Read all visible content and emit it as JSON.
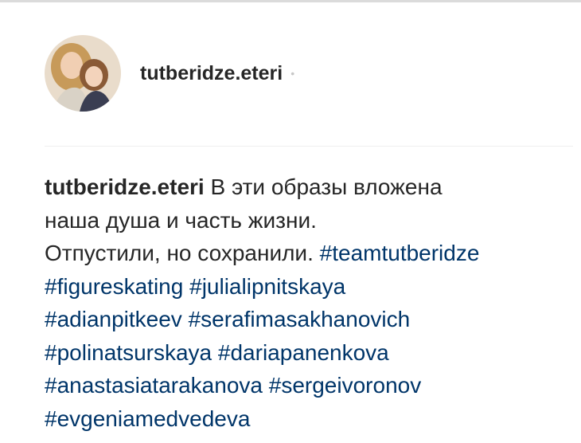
{
  "post": {
    "username": "tutberidze.eteri",
    "header_separator": "•",
    "caption_username": "tutberidze.eteri",
    "caption_text_1": "В эти образы вложена",
    "caption_text_2": "наша душа и часть жизни.",
    "caption_text_3": "Отпустили, но сохранили.",
    "hashtags": [
      "#teamtutberidze",
      "#figureskating",
      "#julialipnitskaya",
      "#adianpitkeev",
      "#serafimasakhanovich",
      "#polinatsurskaya",
      "#dariapanenkova",
      "#anastasiatarakanova",
      "#sergeivoronov",
      "#evgeniamedvedeva"
    ]
  },
  "colors": {
    "text": "#262626",
    "hashtag": "#003569",
    "divider": "#efefef"
  },
  "icons": {
    "avatar": "profile-photo"
  }
}
